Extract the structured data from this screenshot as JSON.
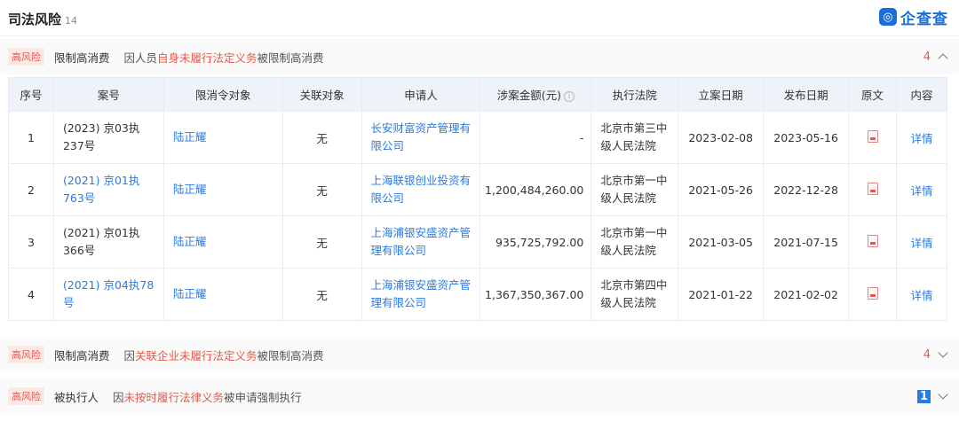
{
  "header": {
    "title": "司法风险",
    "count": "14",
    "logo_mark": "◎",
    "logo_text": "企查查"
  },
  "sections": [
    {
      "badge": "高风险",
      "type": "限制高消费",
      "desc_pre": "因人员",
      "desc_hl": "自身未履行法定义务",
      "desc_post": "被限制高消费",
      "count": "4"
    },
    {
      "badge": "高风险",
      "type": "限制高消费",
      "desc_pre": "因",
      "desc_hl": "关联企业未履行法定义务",
      "desc_post": "被限制高消费",
      "count": "4"
    },
    {
      "badge": "高风险",
      "type": "被执行人",
      "desc_pre": "因",
      "desc_hl": "未按时履行法律义务",
      "desc_post": "被申请强制执行",
      "count": "1"
    }
  ],
  "table": {
    "headers": [
      "序号",
      "案号",
      "限消令对象",
      "关联对象",
      "申请人",
      "涉案金额(元)",
      "执行法院",
      "立案日期",
      "发布日期",
      "原文",
      "内容"
    ],
    "rows": [
      {
        "no": "1",
        "case": "(2023) 京03执237号",
        "target": "陆正耀",
        "related": "无",
        "applicant": "长安财富资产管理有限公司",
        "amount": "-",
        "court": "北京市第三中级人民法院",
        "filed": "2023-02-08",
        "published": "2023-05-16",
        "detail": "详情"
      },
      {
        "no": "2",
        "case": "(2021) 京01执763号",
        "target": "陆正耀",
        "related": "无",
        "applicant": "上海联银创业投资有限公司",
        "amount": "1,200,484,260.00",
        "court": "北京市第一中级人民法院",
        "filed": "2021-05-26",
        "published": "2022-12-28",
        "detail": "详情"
      },
      {
        "no": "3",
        "case": "(2021) 京01执366号",
        "target": "陆正耀",
        "related": "无",
        "applicant": "上海浦银安盛资产管理有限公司",
        "amount": "935,725,792.00",
        "court": "北京市第一中级人民法院",
        "filed": "2021-03-05",
        "published": "2021-07-15",
        "detail": "详情"
      },
      {
        "no": "4",
        "case": "(2021) 京04执78号",
        "target": "陆正耀",
        "related": "无",
        "applicant": "上海浦银安盛资产管理有限公司",
        "amount": "1,367,350,367.00",
        "court": "北京市第四中级人民法院",
        "filed": "2021-01-22",
        "published": "2021-02-02",
        "detail": "详情"
      }
    ]
  },
  "colors": {
    "risk": "#e45a4c",
    "link": "#2a7be0",
    "header_bg": "#eef3f9"
  }
}
